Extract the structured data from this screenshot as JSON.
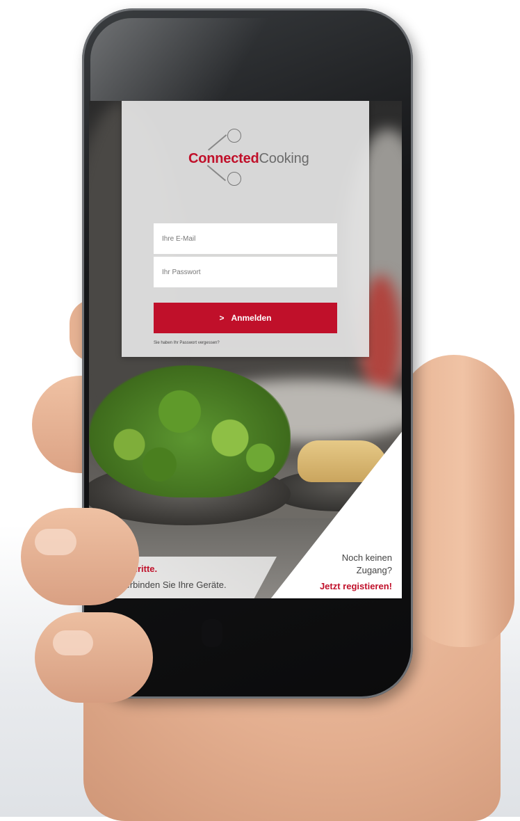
{
  "brand": {
    "name_bold": "Connected",
    "name_regular": "Cooking"
  },
  "login": {
    "email_placeholder": "Ihre E-Mail",
    "password_placeholder": "Ihr Passwort",
    "submit_icon": ">",
    "submit_label": "Anmelden",
    "forgot_password": "Sie haben Ihr Passwort vergessen?"
  },
  "first_steps": {
    "title": "Erste Schritte.",
    "icon": ">",
    "subtitle": "So verbinden Sie Ihre Geräte."
  },
  "register": {
    "prompt_line1": "Noch keinen",
    "prompt_line2": "Zugang?",
    "link": "Jetzt registieren!"
  },
  "colors": {
    "accent": "#c0102a",
    "text_gray": "#6b6b6b"
  }
}
